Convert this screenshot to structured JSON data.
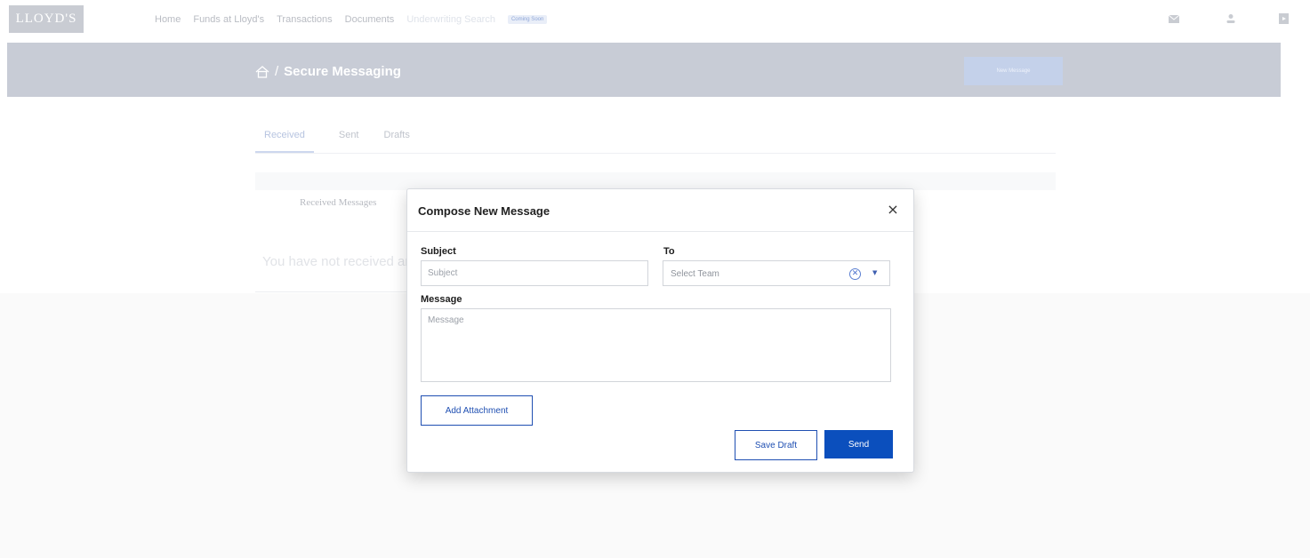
{
  "app": {
    "logo_text": "LLOYD'S"
  },
  "nav": {
    "items": [
      "Home",
      "Funds at Lloyd's",
      "Transactions",
      "Documents",
      "Underwriting Search"
    ],
    "coming_soon_badge": "Coming Soon"
  },
  "header": {
    "breadcrumb_separator": "/",
    "page_title": "Secure Messaging",
    "new_message_label": "New Message"
  },
  "tabs": [
    "Received",
    "Sent",
    "Drafts"
  ],
  "inbox": {
    "section_label": "Received Messages",
    "empty_text": "You have not received any messages"
  },
  "modal": {
    "title": "Compose New Message",
    "close_glyph": "×",
    "subject": {
      "label": "Subject",
      "placeholder": "Subject",
      "value": ""
    },
    "to": {
      "label": "To",
      "placeholder": "Select Team"
    },
    "message": {
      "label": "Message",
      "placeholder": "Message",
      "value": ""
    },
    "add_attachment_label": "Add Attachment",
    "save_draft_label": "Save Draft",
    "send_label": "Send"
  },
  "icons": {
    "top_right": [
      "mail-icon",
      "user-icon",
      "logout-icon"
    ],
    "breadcrumb": "home-icon",
    "select_clear": "clear-circle-icon",
    "select_caret": "caret-down-icon"
  },
  "colors": {
    "primary": "#0b4fbd",
    "header_band": "#c8ccd6",
    "overlay_text": "#b9bcc3"
  }
}
